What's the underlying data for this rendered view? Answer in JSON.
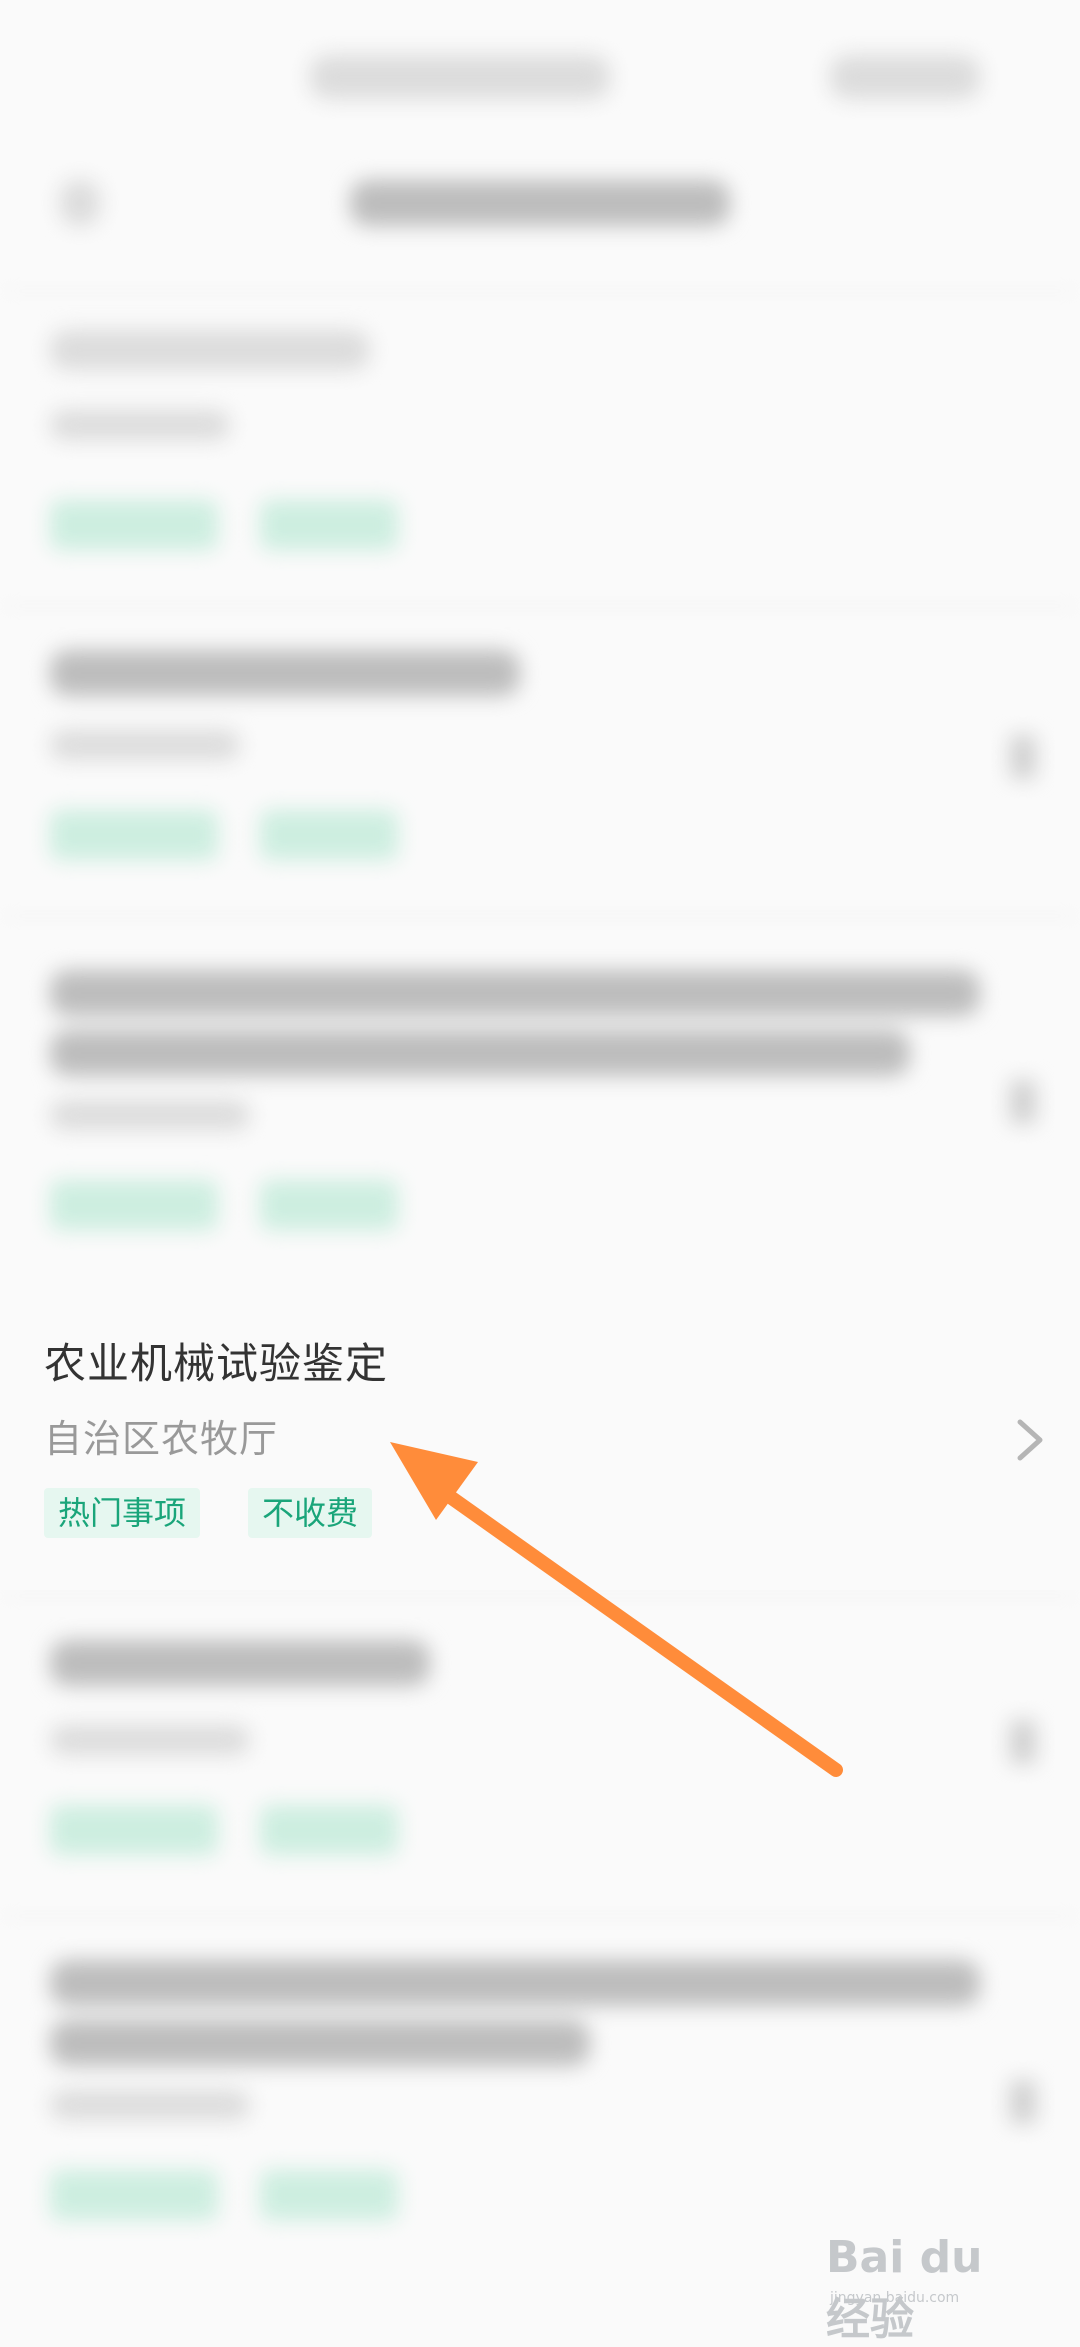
{
  "item": {
    "title": "农业机械试验鉴定",
    "department": "自治区农牧厅",
    "tags": [
      "热门事项",
      "不收费"
    ]
  },
  "colors": {
    "tag_text": "#1aa57a",
    "tag_bg": "#e6f7f0",
    "arrow": "#ff8c3a"
  },
  "icons": [
    "chevron-right-icon",
    "annotation-arrow-icon"
  ],
  "watermark": {
    "brand": "Bai du 经验",
    "url": "jingyan.baidu.com"
  }
}
